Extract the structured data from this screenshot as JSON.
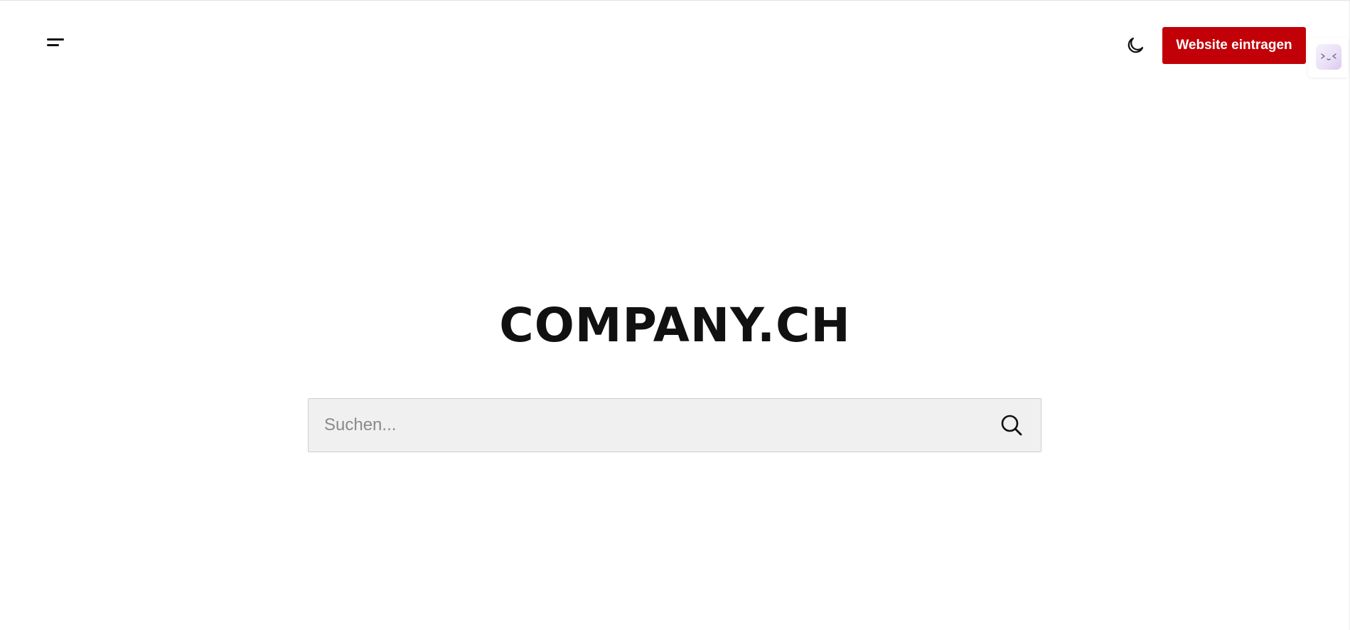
{
  "header": {
    "menu_icon": "menu-icon",
    "theme_icon": "moon-icon",
    "cta_label": "Website eintragen",
    "widget_icon": "chat-face-icon"
  },
  "hero": {
    "logo_text": "COMPANY.CH"
  },
  "search": {
    "placeholder": "Suchen...",
    "value": "",
    "icon": "search-icon"
  },
  "colors": {
    "accent": "#c20008",
    "text": "#111111",
    "search_bg": "#f0f0f0"
  }
}
